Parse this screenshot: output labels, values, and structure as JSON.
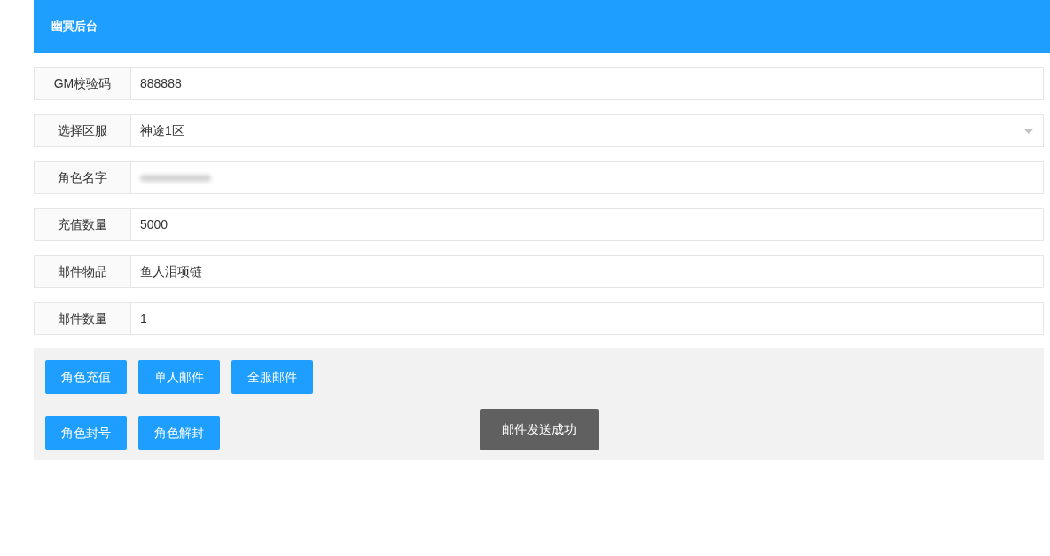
{
  "header": {
    "title": "幽冥后台"
  },
  "form": {
    "fields": [
      {
        "label": "GM校验码",
        "kind": "text",
        "value": "888888"
      },
      {
        "label": "选择区服",
        "kind": "select",
        "value": "神途1区"
      },
      {
        "label": "角色名字",
        "kind": "redacted"
      },
      {
        "label": "充值数量",
        "kind": "text",
        "value": "5000"
      },
      {
        "label": "邮件物品",
        "kind": "text",
        "value": "鱼人泪项链"
      },
      {
        "label": "邮件数量",
        "kind": "text",
        "value": "1"
      }
    ]
  },
  "actions": {
    "rows": [
      [
        "角色充值",
        "单人邮件",
        "全服邮件"
      ],
      [
        "角色封号",
        "角色解封"
      ]
    ]
  },
  "toast": {
    "text": "邮件发送成功"
  }
}
